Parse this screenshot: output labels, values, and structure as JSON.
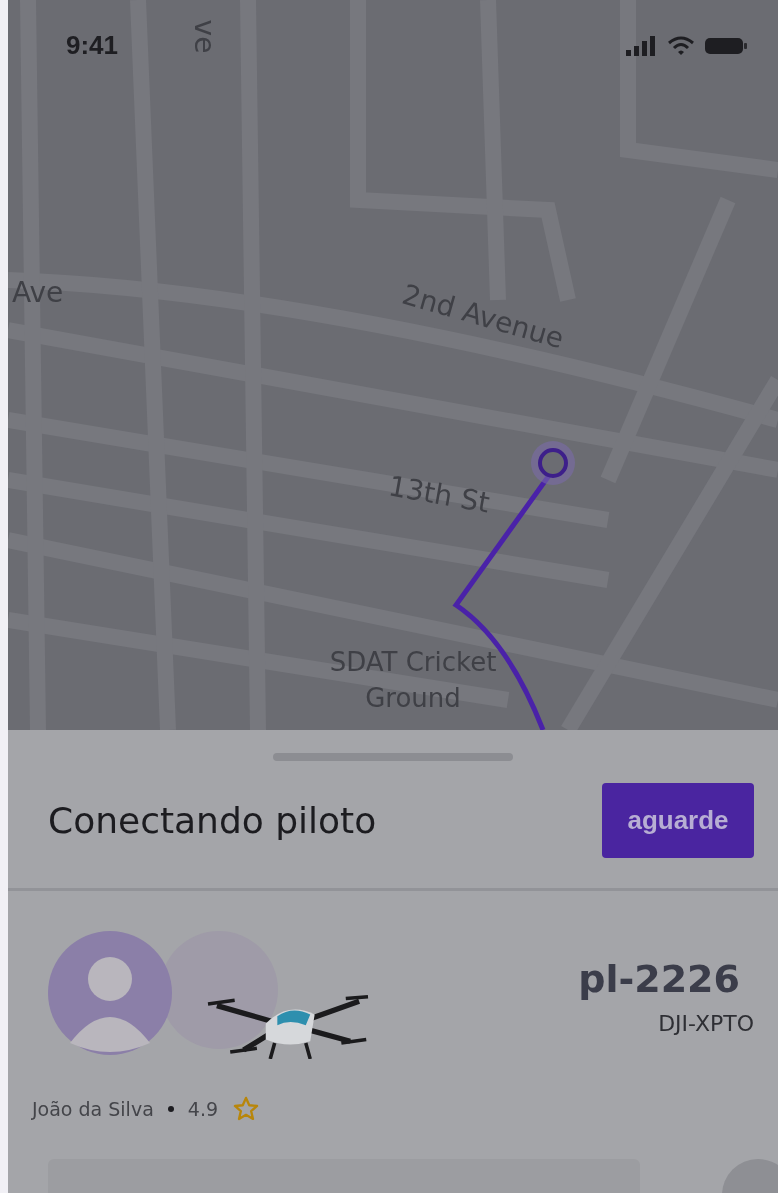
{
  "status_bar": {
    "time": "9:41"
  },
  "map": {
    "labels": [
      {
        "text": "ve",
        "kind": "vertical"
      },
      {
        "text": "Ave",
        "kind": "street"
      },
      {
        "text": "2nd Avenue",
        "kind": "avenue"
      },
      {
        "text": "13th St",
        "kind": "street2"
      },
      {
        "text": "SDAT Cricket Ground",
        "kind": "place"
      }
    ]
  },
  "sheet": {
    "title": "Conectando piloto",
    "status_button": "aguarde",
    "pilot": {
      "name": "João da Silva",
      "rating": "4.9"
    },
    "drone": {
      "code": "pl-2226",
      "model": "DJI-XPTO"
    }
  }
}
